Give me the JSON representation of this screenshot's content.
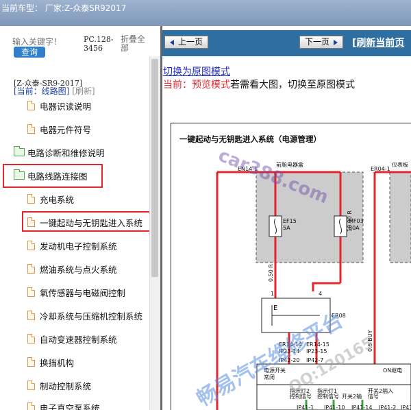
{
  "topbar": {
    "text": "当前车型：  厂家:Z-众泰SR92017"
  },
  "sidebar": {
    "search_placeholder": "输入关键字！",
    "search_button": "查询",
    "pc_code": "PC.128-3456",
    "collapse_all": "折叠全部",
    "model": "[Z-众泰-SR9-2017]",
    "current_label": "[当前：线路图]",
    "refresh_label": "[刷新]",
    "items": [
      {
        "label": "电器识读说明",
        "type": "doc"
      },
      {
        "label": "电器元件符号",
        "type": "doc"
      },
      {
        "label": "电路诊断和维修说明",
        "type": "folder"
      },
      {
        "label": "电路线路连接图",
        "type": "folder"
      },
      {
        "label": "充电系统",
        "type": "doc"
      },
      {
        "label": "一键起动与无钥匙进入系统",
        "type": "doc"
      },
      {
        "label": "发动机电子控制系统",
        "type": "doc"
      },
      {
        "label": "燃油系统与点火系统",
        "type": "doc"
      },
      {
        "label": "氧传感器与电磁阀控制",
        "type": "doc"
      },
      {
        "label": "冷却系统与压缩机控制系统",
        "type": "doc"
      },
      {
        "label": "自动变速器控制系统",
        "type": "doc"
      },
      {
        "label": "换挡机构",
        "type": "doc"
      },
      {
        "label": "制动控制系统",
        "type": "doc"
      },
      {
        "label": "电子真空泵系统",
        "type": "doc"
      }
    ]
  },
  "main": {
    "prev_button": "上一页",
    "next_button": "下一页",
    "refresh_link": "[刷新当前页",
    "switch_link": "切换为原图模式",
    "preview_current": "当前：预览模式",
    "preview_hint": "若需看大图，切换至原图模式",
    "diagram": {
      "title": "一键起动与无钥匙进入系统（电源管理）",
      "labels": {
        "front_box": "前舱电器盒",
        "en14": "EN14-1",
        "er04": "ER04-1",
        "instrument": "仪表板",
        "ef15": "EF15",
        "ef15_amp": "5A",
        "mf03": "MF03",
        "mf03_amp": "80A",
        "wire_r": "10.00 R",
        "wire_05r": "0.50 R",
        "wire_05buy": "0.5 BUY",
        "er08": "ER08",
        "e": "E",
        "er14_14": "ER14-14",
        "er14_15": "ER14-15",
        "ip23_14": "IP23-14",
        "ip23_15": "IP23-15",
        "ip42_20": "IP42-20",
        "ip42_7": "IP42-7",
        "pin1": "1",
        "pin4": "4",
        "on_label": "ON继电",
        "sub1": "指示灯2",
        "sub1b": "控制信号",
        "sub2": "指示灯1",
        "sub2b": "控制信号",
        "sub3": "开关2输",
        "sub4": "开关2输入",
        "sub4b": "信号",
        "ip41_1": "IP41-1",
        "ip41_10": "IP41-10",
        "ip41_14": "IP41-14",
        "ip41_2": "IP41-2",
        "ip41_3": "IP41-3",
        "pwr_sw": "电源开关",
        "pwr_sw2": "常闭"
      }
    },
    "watermarks": {
      "site": "car388.com",
      "brand": "畅易汽车维修平台",
      "qq": "QQ:120165"
    }
  },
  "colors": {
    "accent_blue": "#2f6ea0",
    "highlight_red": "#e3262a",
    "wire_red": "#e3262a",
    "wire_green": "#3aa83a"
  }
}
